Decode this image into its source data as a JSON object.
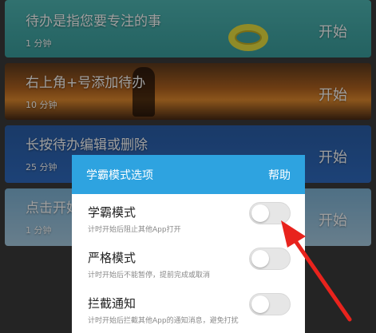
{
  "tasks": [
    {
      "title": "待办是指您要专注的事",
      "duration": "1 分钟",
      "action": "开始"
    },
    {
      "title": "右上角+号添加待办",
      "duration": "10 分钟",
      "action": "开始"
    },
    {
      "title": "长按待办编辑或删除",
      "duration": "25 分钟",
      "action": "开始"
    },
    {
      "title": "点击开始",
      "duration": "1 分钟",
      "action": "开始"
    }
  ],
  "dialog": {
    "title": "学霸模式选项",
    "help": "帮助",
    "options": [
      {
        "title": "学霸模式",
        "desc": "计时开始后阻止其他App打开",
        "enabled": false
      },
      {
        "title": "严格模式",
        "desc": "计时开始后不能暂停，提前完成或取消",
        "enabled": false
      },
      {
        "title": "拦截通知",
        "desc": "计时开始后拦截其他App的通知消息，避免打扰",
        "enabled": false
      }
    ]
  },
  "colors": {
    "dialog_header": "#2ea3e0",
    "annotation_arrow": "#e8231d"
  }
}
